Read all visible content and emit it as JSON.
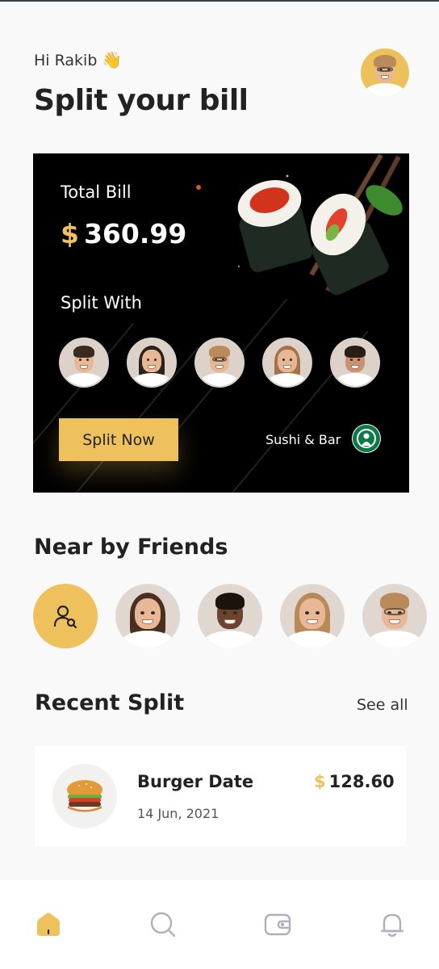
{
  "header": {
    "greeting": "Hi Rakib",
    "wave_emoji": "👋",
    "title": "Split your bill"
  },
  "bill_card": {
    "total_label": "Total Bill",
    "currency": "$",
    "amount": "360.99",
    "split_with_label": "Split With",
    "split_button": "Split Now",
    "venue": "Sushi & Bar"
  },
  "nearby": {
    "title": "Near by Friends"
  },
  "recent": {
    "title": "Recent Split",
    "see_all": "See all",
    "items": [
      {
        "name": "Burger Date",
        "date": "14 Jun, 2021",
        "currency": "$",
        "amount": "128.60"
      }
    ]
  },
  "tabbar": {
    "active": "home"
  },
  "colors": {
    "accent": "#efc15d",
    "card_bg": "#000000",
    "page_bg": "#f9f9f9"
  }
}
